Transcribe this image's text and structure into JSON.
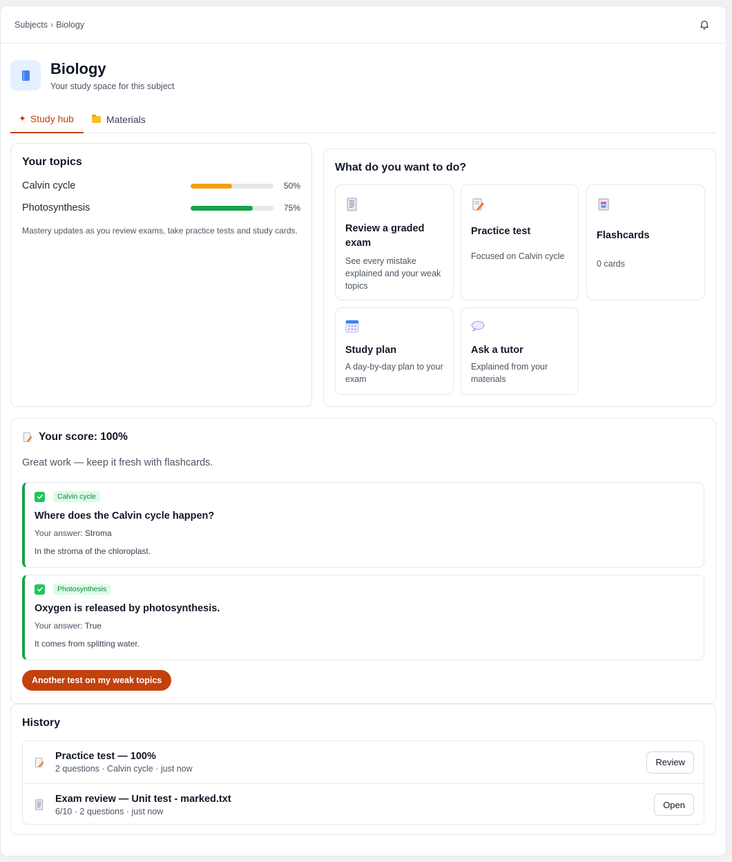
{
  "breadcrumb": {
    "root": "Subjects",
    "separator": "›",
    "current": "Biology"
  },
  "header": {
    "title": "Biology",
    "subtitle": "Your study space for this subject"
  },
  "tabs": [
    {
      "label": "Study hub",
      "icon": "sparkle-icon",
      "active": true
    },
    {
      "label": "Materials",
      "icon": "folder-icon",
      "active": false
    }
  ],
  "topics": {
    "title": "Your topics",
    "items": [
      {
        "name": "Calvin cycle",
        "percent_label": "50%",
        "mastery": 0.5,
        "color": "#f59e0b"
      },
      {
        "name": "Photosynthesis",
        "percent_label": "75%",
        "mastery": 0.75,
        "color": "#16a34a"
      }
    ],
    "note": "Mastery updates as you review exams, take practice tests and study cards."
  },
  "actions": {
    "title": "What do you want to do?",
    "items": [
      {
        "title": "Review a graded exam",
        "desc": "See every mistake explained and your weak topics",
        "icon": "exam-document-icon"
      },
      {
        "title": "Practice test",
        "desc": "Focused on Calvin cycle",
        "icon": "practice-test-icon"
      },
      {
        "title": "Flashcards",
        "desc": "0 cards",
        "icon": "flashcards-icon"
      },
      {
        "title": "Study plan",
        "desc": "A day-by-day plan to your exam",
        "icon": "calendar-icon"
      },
      {
        "title": "Ask a tutor",
        "desc": "Explained from your materials",
        "icon": "speech-bubble-icon"
      }
    ]
  },
  "score": {
    "title": "Your score: 100%",
    "subtitle": "Great work — keep it fresh with flashcards.",
    "questions": [
      {
        "tag": "Calvin cycle",
        "question": "Where does the Calvin cycle happen?",
        "answer_label": "Your answer:",
        "answer": "Stroma",
        "explanation": "In the stroma of the chloroplast."
      },
      {
        "tag": "Photosynthesis",
        "question": "Oxygen is released by photosynthesis.",
        "answer_label": "Your answer:",
        "answer": "True",
        "explanation": "It comes from splitting water."
      }
    ],
    "cta": "Another test on my weak topics"
  },
  "history": {
    "title": "History",
    "items": [
      {
        "title": "Practice test — 100%",
        "meta": "2 questions · Calvin cycle · just now",
        "button": "Review",
        "icon": "practice-test-icon"
      },
      {
        "title": "Exam review — Unit test - marked.txt",
        "meta": "6/10 · 2 questions · just now",
        "button": "Open",
        "icon": "exam-document-icon"
      }
    ]
  },
  "colors": {
    "accent": "#c2410c",
    "success": "#16a34a",
    "warning": "#f59e0b"
  }
}
